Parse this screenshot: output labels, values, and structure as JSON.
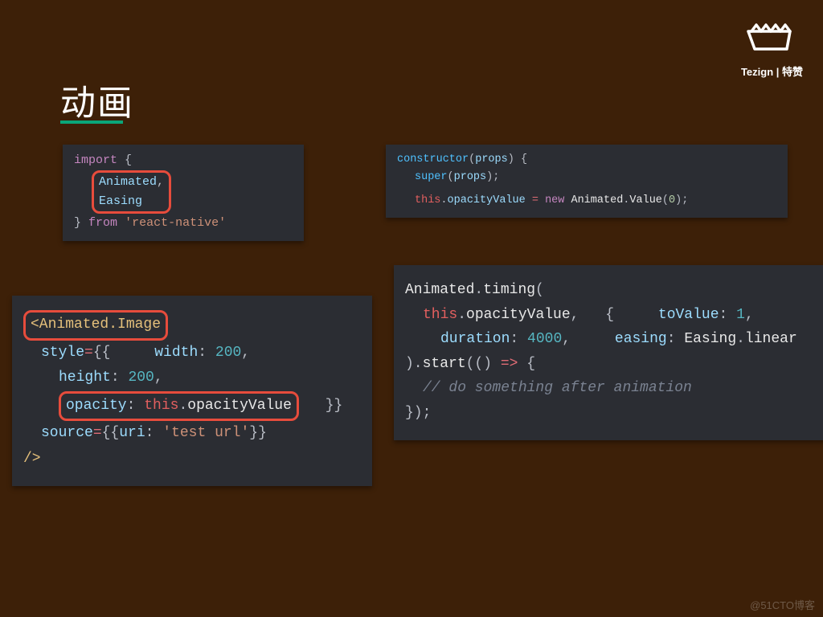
{
  "title": "动画",
  "brand": "Tezign | 特赞",
  "watermark": "@51CTO博客",
  "snippet_import": {
    "line_import": "import",
    "brace_open": "{",
    "item1": "Animated",
    "item2": "Easing",
    "brace_close": "}",
    "from_kw": "from",
    "module": "'react-native'"
  },
  "snippet_constructor": {
    "kw_constructor": "constructor",
    "param": "props",
    "kw_super": "super",
    "kw_this": "this",
    "prop_opacity": "opacityValue",
    "kw_new": "new",
    "class_animated": "Animated",
    "method_value": "Value",
    "arg_zero": "0"
  },
  "snippet_jsx": {
    "tag_open": "<Animated.Image",
    "prop_style": "style",
    "prop_width": "width",
    "val_width": "200",
    "prop_height": "height",
    "val_height": "200",
    "prop_opacity": "opacity",
    "kw_this": "this",
    "this_prop": "opacityValue",
    "prop_source": "source",
    "prop_uri": "uri",
    "val_uri": "'test url'",
    "tag_close": "/>"
  },
  "snippet_timing": {
    "class": "Animated",
    "method": "timing",
    "kw_this": "this",
    "this_prop": "opacityValue",
    "opt_toValue": "toValue",
    "val_toValue": "1",
    "opt_duration": "duration",
    "val_duration": "4000",
    "opt_easing": "easing",
    "val_easing_class": "Easing",
    "val_easing_method": "linear",
    "method_start": "start",
    "comment": "// do something after animation"
  }
}
